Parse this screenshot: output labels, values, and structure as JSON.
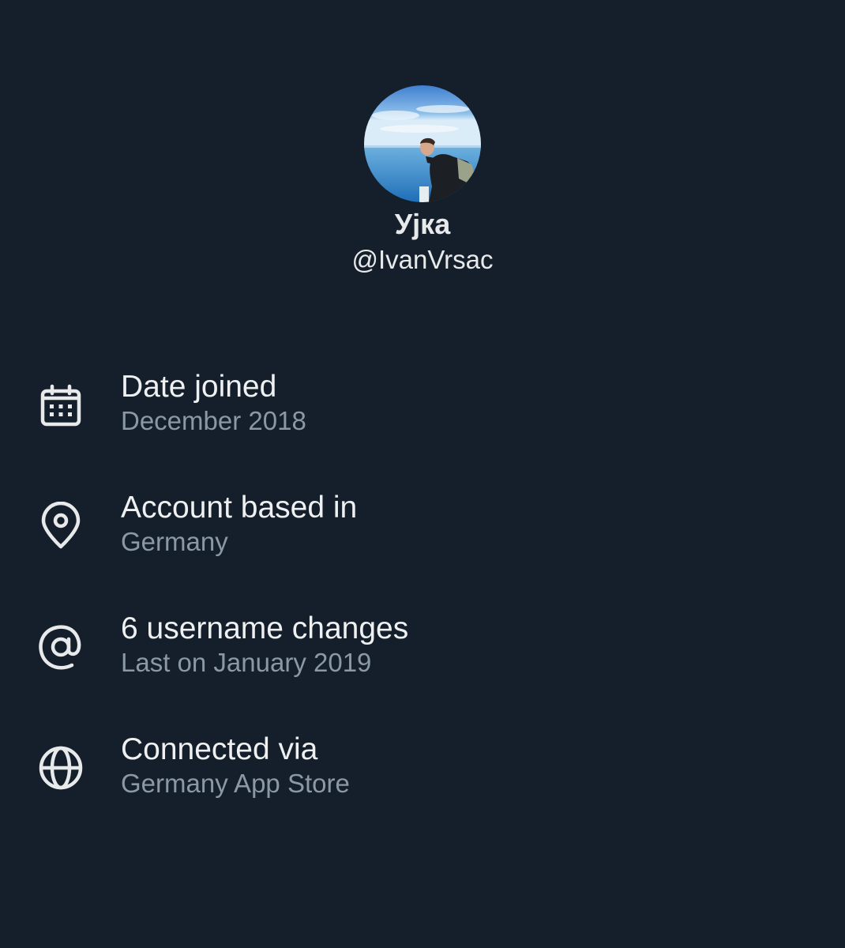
{
  "profile": {
    "display_name": "Ујка",
    "handle": "@IvanVrsac"
  },
  "info_items": [
    {
      "icon": "calendar-icon",
      "title": "Date joined",
      "subtitle": "December 2018"
    },
    {
      "icon": "location-pin-icon",
      "title": "Account based in",
      "subtitle": "Germany"
    },
    {
      "icon": "at-sign-icon",
      "title": "6 username changes",
      "subtitle": "Last on January 2019"
    },
    {
      "icon": "globe-icon",
      "title": "Connected via",
      "subtitle": "Germany App Store"
    }
  ],
  "colors": {
    "background": "#151f2b",
    "primary_text": "#e7e9ea",
    "secondary_text": "#8b98a5"
  }
}
